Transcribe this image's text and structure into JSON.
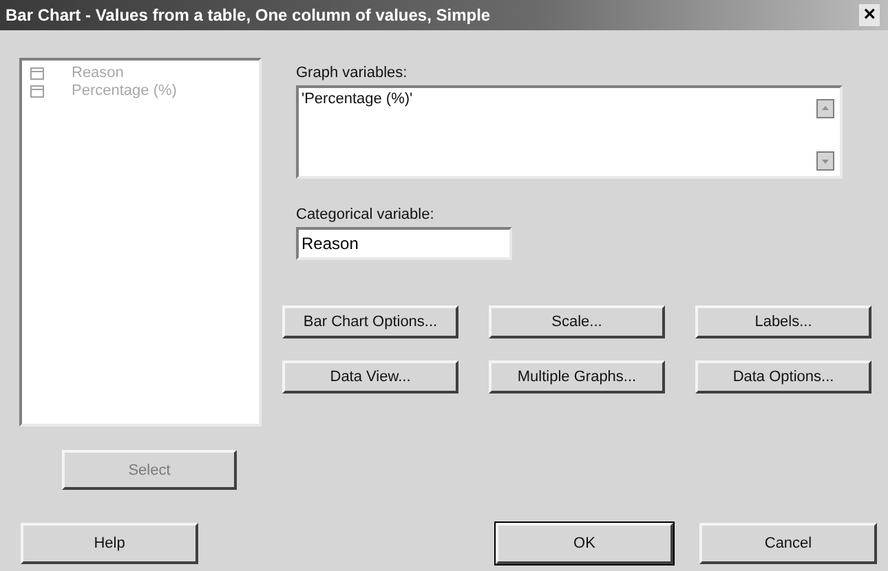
{
  "window": {
    "title": "Bar Chart - Values from a table, One column of values, Simple",
    "close": "×"
  },
  "columns_list": {
    "items": [
      {
        "name": "Reason",
        "disabled": true
      },
      {
        "name": "Percentage (%)",
        "disabled": true
      }
    ]
  },
  "graph_variables": {
    "label": "Graph variables:",
    "value": "'Percentage (%)'"
  },
  "categorical_variable": {
    "label": "Categorical variable:",
    "value": "Reason"
  },
  "option_buttons": [
    {
      "label": "Bar Chart Options..."
    },
    {
      "label": "Scale..."
    },
    {
      "label": "Labels..."
    },
    {
      "label": "Data View..."
    },
    {
      "label": "Multiple Graphs..."
    },
    {
      "label": "Data Options..."
    }
  ],
  "select_button": {
    "label": "Select",
    "disabled": true
  },
  "dialog_buttons": [
    {
      "label": "Help",
      "default": false
    },
    {
      "label": "OK",
      "default": true
    },
    {
      "label": "Cancel",
      "default": false
    }
  ]
}
